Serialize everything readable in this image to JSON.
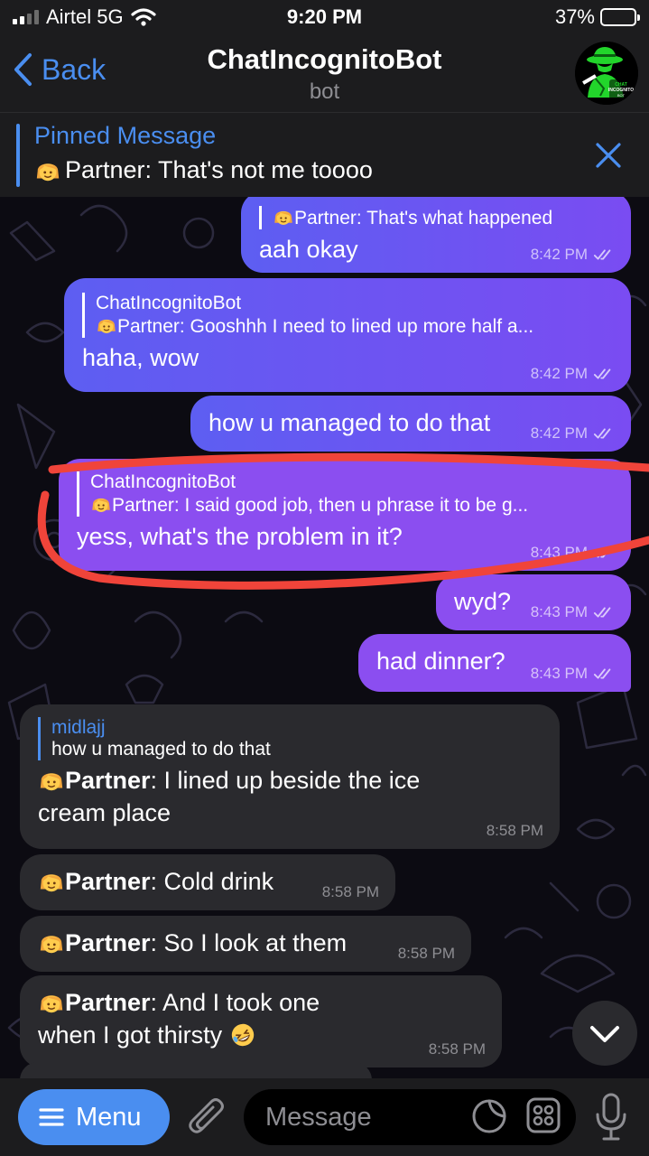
{
  "status_bar": {
    "carrier": "Airtel 5G",
    "time": "9:20 PM",
    "battery": "37%",
    "battery_level": 0.37
  },
  "header": {
    "back_label": "Back",
    "title": "ChatIncognitoBot",
    "subtitle": "bot"
  },
  "pinned": {
    "title": "Pinned Message",
    "text": "Partner: That's not me toooo"
  },
  "messages": [
    {
      "reply_text": "Partner: That's what happened",
      "text": "aah okay",
      "time": "8:42 PM"
    },
    {
      "reply_name": "ChatIncognitoBot",
      "reply_text": "Partner: Gooshhh I need to lined up more half a...",
      "text": "haha, wow",
      "time": "8:42 PM"
    },
    {
      "text": "how u managed to do that",
      "time": "8:42 PM"
    },
    {
      "reply_name": "ChatIncognitoBot",
      "reply_text": "Partner: I said good job, then u phrase it to be g...",
      "text": "yess, what's the problem in it?",
      "time": "8:43 PM"
    },
    {
      "text": "wyd?",
      "time": "8:43 PM"
    },
    {
      "text": "had dinner?",
      "time": "8:43 PM"
    },
    {
      "reply_name": "midlajj",
      "reply_text": "how u managed to do that",
      "sender": "Partner",
      "text": ": I lined up beside the ice cream place",
      "time": "8:58 PM"
    },
    {
      "sender": "Partner",
      "text": ": Cold drink",
      "time": "8:58 PM"
    },
    {
      "sender": "Partner",
      "text": ": So I look at them",
      "time": "8:58 PM"
    },
    {
      "sender": "Partner",
      "text": ": And I took one when I got thirsty",
      "time": "8:58 PM"
    }
  ],
  "input_bar": {
    "menu_label": "Menu",
    "placeholder": "Message"
  },
  "colors": {
    "accent": "#4a8ef0",
    "outgoing": "#6a55f2",
    "incoming": "#2a2a2e",
    "highlight": "#f0443a"
  },
  "icons": [
    "signal-icon",
    "wifi-icon",
    "battery-icon",
    "chevron-left-icon",
    "close-icon",
    "read-checks-icon",
    "chevron-down-icon",
    "menu-icon",
    "paperclip-icon",
    "sticker-icon",
    "command-icon",
    "mic-icon",
    "face-emoji",
    "laughing-emoji"
  ]
}
